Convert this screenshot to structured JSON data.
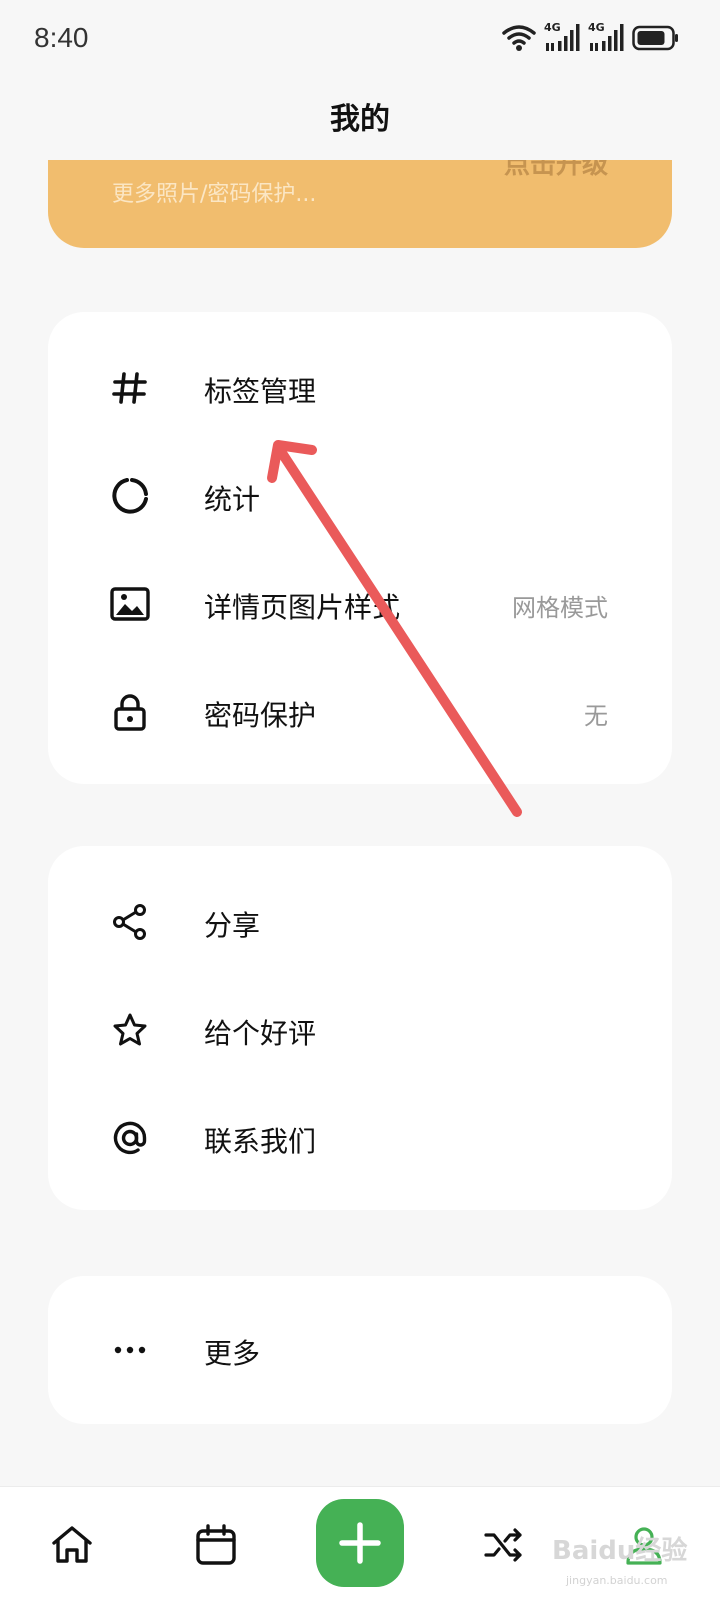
{
  "status_bar": {
    "time": "8:40",
    "network_1": "4G",
    "network_2": "4G"
  },
  "header": {
    "title": "我的"
  },
  "promo": {
    "subtitle": "更多照片/密码保护...",
    "action": "点击升级"
  },
  "group_1": {
    "items": [
      {
        "icon": "hash-icon",
        "label": "标签管理",
        "value": ""
      },
      {
        "icon": "pie-chart-icon",
        "label": "统计",
        "value": ""
      },
      {
        "icon": "image-icon",
        "label": "详情页图片样式",
        "value": "网格模式"
      },
      {
        "icon": "lock-icon",
        "label": "密码保护",
        "value": "无"
      }
    ]
  },
  "group_2": {
    "items": [
      {
        "icon": "share-icon",
        "label": "分享"
      },
      {
        "icon": "star-icon",
        "label": "给个好评"
      },
      {
        "icon": "at-icon",
        "label": "联系我们"
      }
    ]
  },
  "group_3": {
    "items": [
      {
        "icon": "more-icon",
        "label": "更多"
      }
    ]
  },
  "tab_bar": {
    "tabs": [
      "home-icon",
      "calendar-icon",
      "add-icon",
      "shuffle-icon",
      "profile-icon"
    ],
    "active_color": "#45b155"
  },
  "watermark": {
    "text": "Baidu经验",
    "sub": "jingyan.baidu.com"
  },
  "colors": {
    "banner": "#f1bd6e",
    "accent": "#45b155",
    "annotation_arrow": "#ea5a5a"
  }
}
